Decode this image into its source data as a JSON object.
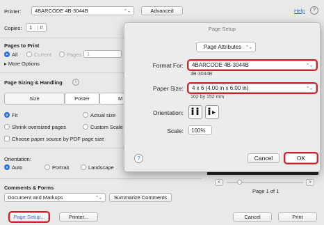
{
  "top": {
    "printer_label": "Printer:",
    "printer_value": "4BARCODE 4B-3044B",
    "advanced_label": "Advanced",
    "help_label": "Help",
    "copies_label": "Copies:",
    "copies_value": "1"
  },
  "pages": {
    "heading": "Pages to Print",
    "all_label": "All",
    "current_label": "Current",
    "pages_label": "Pages",
    "pages_value": "1",
    "more_options_label": "More Options"
  },
  "sizing": {
    "heading": "Page Sizing & Handling",
    "tabs": [
      "Size",
      "Poster",
      "M"
    ],
    "fit_label": "Fit",
    "actual_label": "Actual size",
    "shrink_label": "Shrink oversized pages",
    "custom_label": "Custom Scale",
    "choose_source_label": "Choose paper source by PDF page size"
  },
  "orientation": {
    "heading": "Orientation:",
    "auto_label": "Auto",
    "portrait_label": "Portrait",
    "landscape_label": "Landscape"
  },
  "comments": {
    "heading": "Comments & Forms",
    "select_value": "Document and Markups",
    "summarize_label": "Summarize Comments"
  },
  "bottom": {
    "page_setup_label": "Page Setup...",
    "printer_label": "Printer...",
    "cancel_label": "Cancel",
    "print_label": "Print",
    "page_of": "Page 1 of 1"
  },
  "dialog": {
    "title": "Page Setup",
    "attributes_value": "Page Attributes",
    "format_label": "Format For:",
    "format_value": "4BARCODE 4B-3044B",
    "format_sub": "4B-3044B",
    "paper_label": "Paper Size:",
    "paper_value": "4 x 6 (4.00 in x 6.00 in)",
    "paper_sub": "102 by 152 mm",
    "orientation_label": "Orientation:",
    "scale_label": "Scale:",
    "scale_value": "100%",
    "help_glyph": "?",
    "cancel_label": "Cancel",
    "ok_label": "OK"
  },
  "colors": {
    "highlight": "#d21f28",
    "accent": "#2e7cf6",
    "link": "#2d6fd6"
  }
}
